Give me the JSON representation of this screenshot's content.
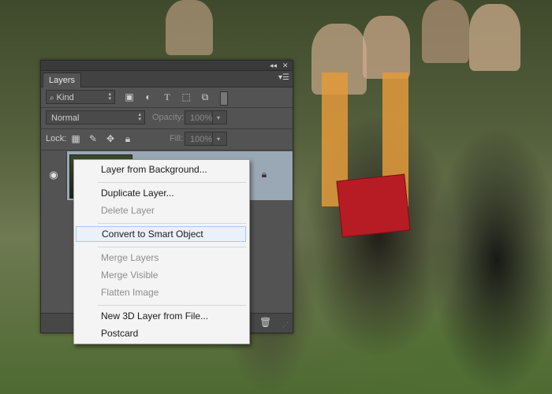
{
  "panel": {
    "tab_label": "Layers",
    "topbar": {
      "collapse_icon": "double-chevron-icon",
      "close_icon": "close-icon"
    },
    "panel_menu_icon": "panel-menu-icon",
    "filter": {
      "kind_label": "Kind",
      "icons": [
        "image-filter-icon",
        "adjustment-filter-icon",
        "type-filter-icon",
        "shape-filter-icon",
        "smart-object-filter-icon"
      ]
    },
    "blend_mode": "Normal",
    "opacity_label": "Opacity:",
    "opacity_value": "100%",
    "lock_label": "Lock:",
    "fill_label": "Fill:",
    "fill_value": "100%",
    "layer": {
      "visibility_icon": "eye-icon",
      "lock_icon": "lock-icon"
    },
    "bottom": {
      "trash_icon": "trash-icon"
    }
  },
  "context_menu": {
    "items": [
      {
        "label": "Layer from Background...",
        "enabled": true
      },
      {
        "label": "Duplicate Layer...",
        "enabled": true
      },
      {
        "label": "Delete Layer",
        "enabled": false
      },
      {
        "label": "Convert to Smart Object",
        "enabled": true,
        "highlighted": true
      },
      {
        "label": "Merge Layers",
        "enabled": false
      },
      {
        "label": "Merge Visible",
        "enabled": false
      },
      {
        "label": "Flatten Image",
        "enabled": false
      },
      {
        "label": "New 3D Layer from File...",
        "enabled": true
      },
      {
        "label": "Postcard",
        "enabled": true
      }
    ]
  },
  "colors": {
    "panel_bg": "#535353",
    "selected_layer": "#9aa7b5",
    "menu_highlight": "#e9f1fb"
  }
}
